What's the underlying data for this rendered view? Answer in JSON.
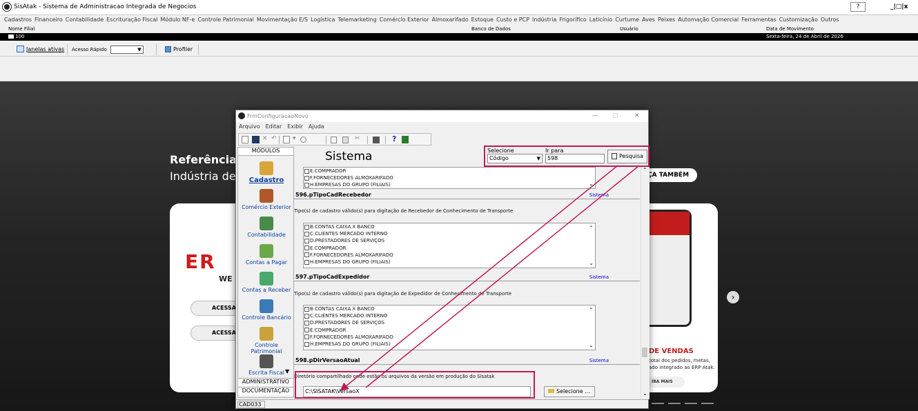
{
  "app": {
    "title": "SisAtak - Sistema de Administracao Integrada de Negocios",
    "help_button": "?",
    "window_controls": "_|□|x"
  },
  "menu": [
    "Cadastros",
    "Financeiro",
    "Contabilidade",
    "Escrituração Fiscal",
    "Módulo NF-e",
    "Controle Patrimonial",
    "Movimentação E/S",
    "Logística",
    "Telemarketing",
    "Comércio Exterior",
    "Almoxarifado",
    "Estoque",
    "Custo e PCP",
    "Indústria",
    "Frigorífico",
    "Laticínio",
    "Curtume",
    "Aves",
    "Peixes",
    "Automação Comercial",
    "Ferramentas",
    "Customização",
    "Outros"
  ],
  "info": {
    "nome_filial_label": "Nome Filial",
    "banco_label": "Banco de Dados",
    "usuario_label": "Usuário",
    "data_label": "Data de Movimento",
    "filial_value": "100",
    "data_value": "Sexta-feira, 24 de Abril de 2026"
  },
  "toolbar": {
    "janelas": "Janelas ativas",
    "acesso": "Acesso Rápido",
    "profiler": "Profiler"
  },
  "background": {
    "referencia": "Referência",
    "industria": "Indústria de",
    "faca": "ÇA TAMBÉM",
    "er": "ER",
    "we": "WE",
    "acessa1": "ACESSA",
    "acessa2": "ACESSA",
    "vendas": "DE VENDAS",
    "vendas_desc1": "total dos pedidos, metas,",
    "vendas_desc2": "ado integrado ao ERP Atak.",
    "saiba": "IBA MAIS"
  },
  "dialog": {
    "title": "FrmConfiguracaoNovo",
    "menu": [
      "Arquivo",
      "Editar",
      "Exibir",
      "Ajuda"
    ],
    "modulos_tab": "MÓDULOS",
    "section_title": "Sistema",
    "selecione_label": "Selecione",
    "selecione_value": "Código",
    "irpara_label": "Ir para",
    "irpara_value": "598",
    "pesquisa": "Pesquisa",
    "modules": [
      "Cadastro",
      "Comércio Exterior",
      "Contabilidade",
      "Contas a Pagar",
      "Contas a Receber",
      "Controle Bancário",
      "Controle Patrimonial",
      "Escrita Fiscal"
    ],
    "bottom_tabs": [
      "ADMINISTRATIVO",
      "DOCUMENTAÇÃO"
    ],
    "status": "CAD033",
    "list0": [
      "E.COMPRADOR",
      "F.FORNECEDORES ALMOXARIFADO",
      "H.EMPRESAS DO GRUPO (FILIAIS)"
    ],
    "params": [
      {
        "name": "596.pTipoCadRecebedor",
        "system": "Sistema",
        "desc": "Tipo(s) de cadastro válido(s) para digitação de Recebedor de Conhecimento de Transporte",
        "items": [
          "B.CONTAS CAIXA X BANCO",
          "C.CLIENTES MERCADO INTERNO",
          "D.PRESTADORES DE SERVIÇOS",
          "E.COMPRADOR",
          "F.FORNECEDORES ALMOXARIFADO",
          "H.EMPRESAS DO GRUPO (FILIAIS)"
        ]
      },
      {
        "name": "597.pTipoCadExpedidor",
        "system": "Sistema",
        "desc": "Tipo(s) de cadastro válido(s) para digitação de Expedidor de Conhecimento de Transporte",
        "items": [
          "B.CONTAS CAIXA X BANCO",
          "C.CLIENTES MERCADO INTERNO",
          "D.PRESTADORES DE SERVIÇOS",
          "E.COMPRADOR",
          "F.FORNECEDORES ALMOXARIFADO",
          "H.EMPRESAS DO GRUPO (FILIAIS)"
        ]
      },
      {
        "name": "598.pDirVersaoAtual",
        "system": "Sistema",
        "desc": "Diretório compartilhado onde estão os arquivos da versão em produção do Sisatak",
        "value": "C:\\SISATAK\\VersaoX",
        "button": "Selecione ..."
      }
    ]
  }
}
